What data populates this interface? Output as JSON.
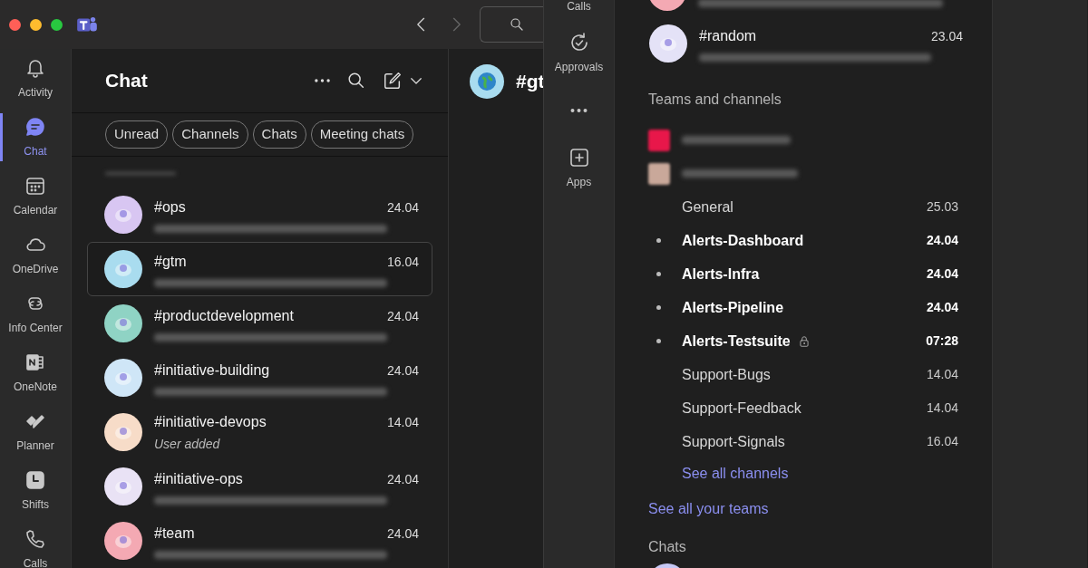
{
  "left_rail": [
    {
      "label": "Activity",
      "selected": false
    },
    {
      "label": "Chat",
      "selected": true
    },
    {
      "label": "Calendar",
      "selected": false
    },
    {
      "label": "OneDrive",
      "selected": false
    },
    {
      "label": "Info Center",
      "selected": false
    },
    {
      "label": "OneNote",
      "selected": false
    },
    {
      "label": "Planner",
      "selected": false
    },
    {
      "label": "Shifts",
      "selected": false
    },
    {
      "label": "Calls",
      "selected": false
    }
  ],
  "chat_panel": {
    "title": "Chat",
    "filters": [
      {
        "label": "Unread",
        "selected": false
      },
      {
        "label": "Channels",
        "selected": false
      },
      {
        "label": "Chats",
        "selected": false
      },
      {
        "label": "Meeting chats",
        "selected": false
      }
    ],
    "chats": [
      {
        "name": "#ops",
        "time": "24.04",
        "selected": false,
        "color": "#d8c6f2"
      },
      {
        "name": "#gtm",
        "time": "16.04",
        "selected": true,
        "color": "#a9dcef"
      },
      {
        "name": "#productdevelopment",
        "time": "24.04",
        "selected": false,
        "color": "#8fd3c4"
      },
      {
        "name": "#initiative-building",
        "time": "24.04",
        "selected": false,
        "color": "#cfe6f7"
      },
      {
        "name": "#initiative-devops",
        "time": "14.04",
        "selected": false,
        "color": "#f7dcc8",
        "preview": "User added"
      },
      {
        "name": "#initiative-ops",
        "time": "24.04",
        "selected": false,
        "color": "#e9e2f5"
      },
      {
        "name": "#team",
        "time": "24.04",
        "selected": false,
        "color": "#f4a9b3"
      }
    ]
  },
  "conversation": {
    "title": "#gt"
  },
  "right_rail": [
    {
      "label": "Calls",
      "kind": "app"
    },
    {
      "label": "Approvals",
      "kind": "app"
    },
    {
      "kind": "more"
    },
    {
      "label": "Apps",
      "kind": "app"
    }
  ],
  "right_list": {
    "chats": [
      {
        "name": "#random",
        "time": "23.04",
        "selected": false,
        "color": "#e4e2f7"
      }
    ],
    "teams_heading": "Teams and channels",
    "channels": [
      {
        "name": "General",
        "time": "25.03",
        "unread": false,
        "private": false
      },
      {
        "name": "Alerts-Dashboard",
        "time": "24.04",
        "unread": true,
        "private": false
      },
      {
        "name": "Alerts-Infra",
        "time": "24.04",
        "unread": true,
        "private": false
      },
      {
        "name": "Alerts-Pipeline",
        "time": "24.04",
        "unread": true,
        "private": false
      },
      {
        "name": "Alerts-Testsuite",
        "time": "07:28",
        "unread": true,
        "private": true
      },
      {
        "name": "Support-Bugs",
        "time": "14.04",
        "unread": false,
        "private": false
      },
      {
        "name": "Support-Feedback",
        "time": "14.04",
        "unread": false,
        "private": false
      },
      {
        "name": "Support-Signals",
        "time": "16.04",
        "unread": false,
        "private": false
      }
    ],
    "see_all_channels": "See all channels",
    "see_all_teams": "See all your teams",
    "chats_heading": "Chats"
  }
}
